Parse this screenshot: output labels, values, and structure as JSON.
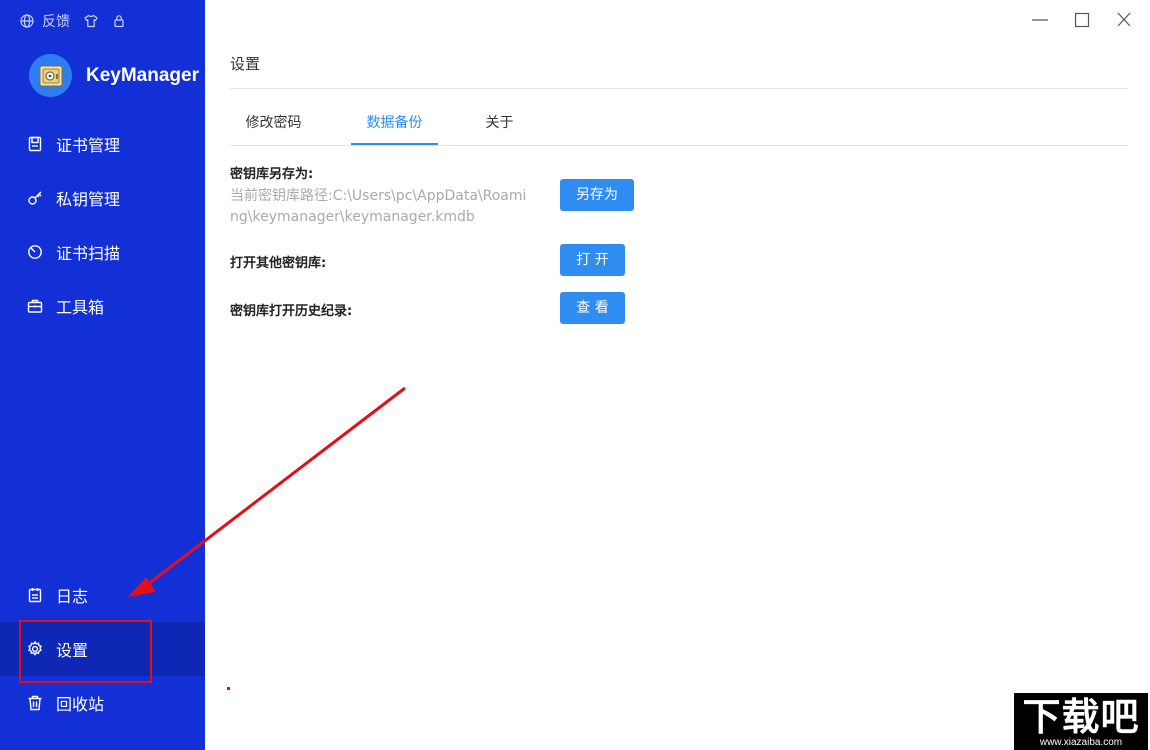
{
  "sidebar": {
    "top": {
      "feedback_label": "反馈"
    },
    "brand_name": "KeyManager",
    "items": [
      {
        "label": "证书管理"
      },
      {
        "label": "私钥管理"
      },
      {
        "label": "证书扫描"
      },
      {
        "label": "工具箱"
      },
      {
        "label": "日志"
      },
      {
        "label": "设置"
      },
      {
        "label": "回收站"
      }
    ],
    "active_item": "设置",
    "accent_color": "#1330d6"
  },
  "main": {
    "page_title": "设置",
    "tabs": [
      {
        "label": "修改密码"
      },
      {
        "label": "数据备份"
      },
      {
        "label": "关于"
      }
    ],
    "active_tab": "数据备份",
    "backup": {
      "save_as_label": "密钥库另存为:",
      "current_path": "当前密钥库路径:C:\\Users\\pc\\AppData\\Roaming\\keymanager\\keymanager.kmdb",
      "save_as_button": "另存为",
      "open_other_label": "打开其他密钥库:",
      "open_button": "打 开",
      "history_label": "密钥库打开历史纪录:",
      "view_button": "查 看"
    },
    "button_color": "#2f8cf0"
  },
  "watermark": {
    "big": "下载吧",
    "small": "www.xiazaiba.com"
  }
}
